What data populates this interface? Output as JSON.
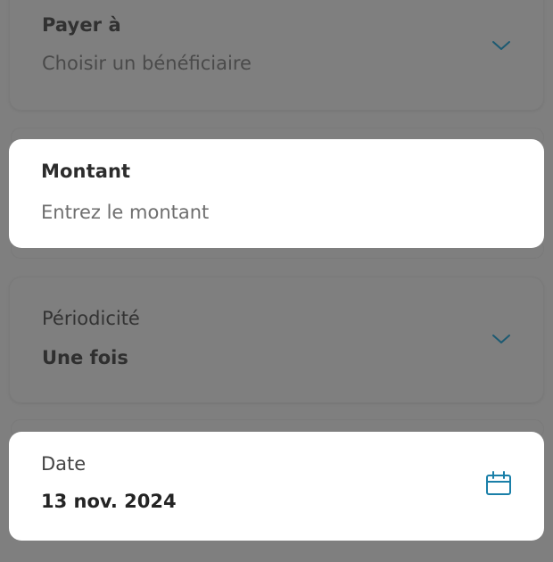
{
  "form": {
    "payee": {
      "label": "Payer à",
      "placeholder": "Choisir un bénéficiaire"
    },
    "amount": {
      "label": "Montant",
      "placeholder": "Entrez le montant"
    },
    "frequency": {
      "label": "Périodicité",
      "value": "Une fois"
    },
    "date": {
      "label": "Date",
      "value": "13 nov. 2024"
    }
  },
  "icons": {
    "payee_dropdown": "chevron-down-icon",
    "frequency_dropdown": "chevron-down-icon",
    "date_picker": "calendar-icon"
  },
  "colors": {
    "overlay": "#7f7f7f",
    "card_active": "#ffffff",
    "accent": "#1a7fa8"
  }
}
